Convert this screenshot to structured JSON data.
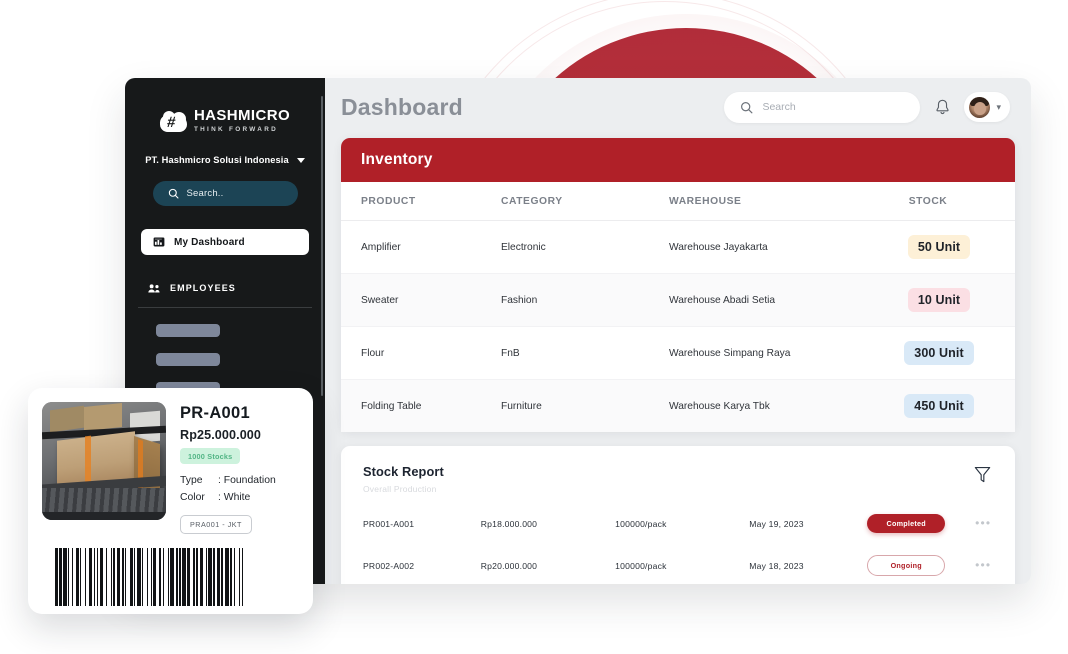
{
  "sidebar": {
    "logo": {
      "name": "HASHMICRO",
      "tagline": "THINK FORWARD",
      "hash": "#"
    },
    "company": "PT. Hashmicro Solusi Indonesia",
    "search_placeholder": "Search..",
    "active_item": "My Dashboard",
    "section_label": "EMPLOYEES",
    "skeleton_items": 4
  },
  "header": {
    "title": "Dashboard",
    "search_placeholder": "Search"
  },
  "inventory": {
    "title": "Inventory",
    "columns": [
      "PRODUCT",
      "CATEGORY",
      "WAREHOUSE",
      "STOCK"
    ],
    "rows": [
      {
        "product": "Amplifier",
        "category": "Electronic",
        "warehouse": "Warehouse Jayakarta",
        "stock": "50 Unit",
        "tone": "amber"
      },
      {
        "product": "Sweater",
        "category": "Fashion",
        "warehouse": "Warehouse Abadi Setia",
        "stock": "10 Unit",
        "tone": "pink"
      },
      {
        "product": "Flour",
        "category": "FnB",
        "warehouse": "Warehouse Simpang Raya",
        "stock": "300 Unit",
        "tone": "blue"
      },
      {
        "product": "Folding Table",
        "category": "Furniture",
        "warehouse": "Warehouse Karya Tbk",
        "stock": "450 Unit",
        "tone": "blue"
      }
    ]
  },
  "stock_report": {
    "title": "Stock Report",
    "subtitle": "Overall Production",
    "rows": [
      {
        "code": "PR001-A001",
        "price": "Rp18.000.000",
        "qty": "100000/pack",
        "date": "May 19, 2023",
        "status": "Completed",
        "status_tone": "completed",
        "more": "•••"
      },
      {
        "code": "PR002-A002",
        "price": "Rp20.000.000",
        "qty": "100000/pack",
        "date": "May 18, 2023",
        "status": "Ongoing",
        "status_tone": "ongoing",
        "more": "•••"
      }
    ]
  },
  "product_card": {
    "code": "PR-A001",
    "price": "Rp25.000.000",
    "stock_badge": "1000 Stocks",
    "type_label": "Type",
    "type_value": ": Foundation",
    "color_label": "Color",
    "color_value": ": White",
    "tag": "PRA001 - JKT"
  },
  "colors": {
    "brand_red": "#b02028",
    "sidebar_bg": "#17191a",
    "app_bg": "#eceef0",
    "badge_amber": "#fdf0d7",
    "badge_pink": "#fbdfe4",
    "badge_blue": "#d9e9f7",
    "stock_green": "#cdf2dd",
    "search_teal": "#1c4455"
  }
}
